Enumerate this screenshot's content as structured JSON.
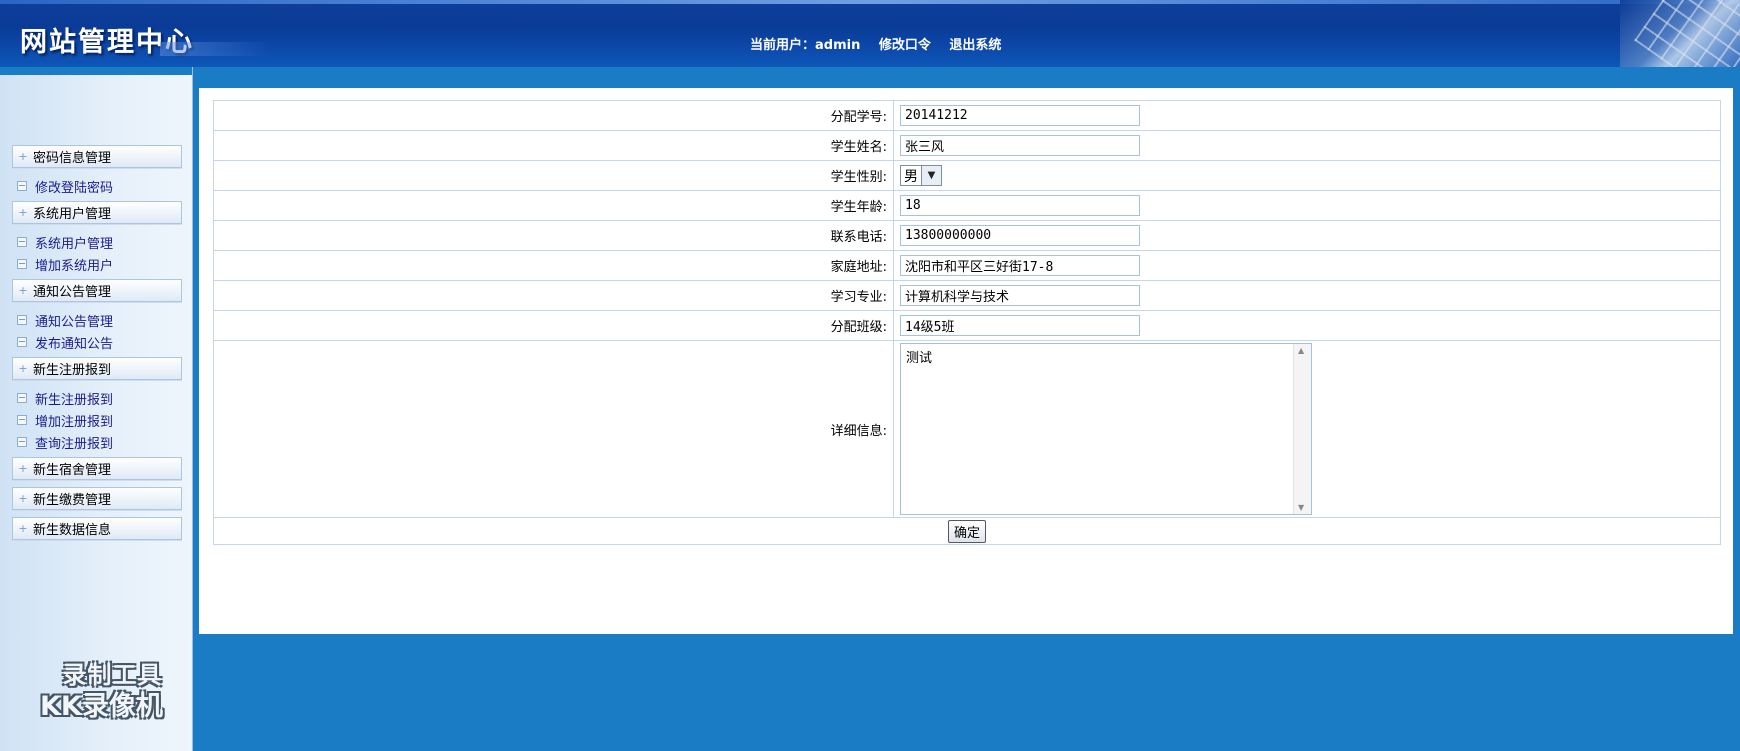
{
  "header": {
    "title": "网站管理中心",
    "user_label": "当前用户：admin",
    "change_password": "修改口令",
    "logout": "退出系统"
  },
  "sidebar": {
    "groups": [
      {
        "label": "密码信息管理",
        "items": [
          "修改登陆密码"
        ]
      },
      {
        "label": "系统用户管理",
        "items": [
          "系统用户管理",
          "增加系统用户"
        ]
      },
      {
        "label": "通知公告管理",
        "items": [
          "通知公告管理",
          "发布通知公告"
        ]
      },
      {
        "label": "新生注册报到",
        "items": [
          "新生注册报到",
          "增加注册报到",
          "查询注册报到"
        ]
      },
      {
        "label": "新生宿舍管理",
        "items": []
      },
      {
        "label": "新生缴费管理",
        "items": []
      },
      {
        "label": "新生数据信息",
        "items": []
      }
    ]
  },
  "watermark": {
    "line1": "录制工具",
    "line2": "KK录像机"
  },
  "form": {
    "fields": [
      {
        "label": "分配学号:",
        "value": "20141212"
      },
      {
        "label": "学生姓名:",
        "value": "张三风"
      },
      {
        "label": "学生性别:",
        "value": "男"
      },
      {
        "label": "学生年龄:",
        "value": "18"
      },
      {
        "label": "联系电话:",
        "value": "13800000000"
      },
      {
        "label": "家庭地址:",
        "value": "沈阳市和平区三好街17-8"
      },
      {
        "label": "学习专业:",
        "value": "计算机科学与技术"
      },
      {
        "label": "分配班级:",
        "value": "14级5班"
      }
    ],
    "detail_label": "详细信息:",
    "detail_value": "测试",
    "submit_label": "确定"
  }
}
